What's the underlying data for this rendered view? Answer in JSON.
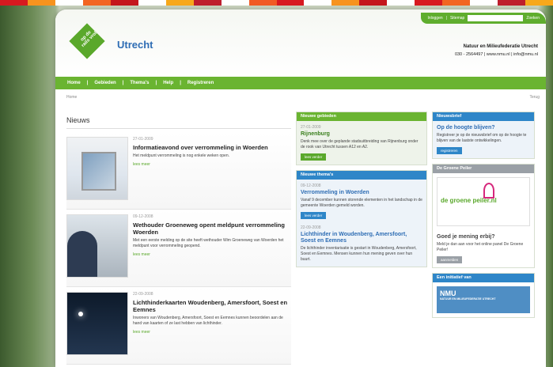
{
  "stripe_colors": [
    "#d71920",
    "#f7931e",
    "#ffffff",
    "#f26522",
    "#c4161c",
    "#ffffff",
    "#f7a81b",
    "#be1e2d",
    "#ffffff",
    "#f15a24",
    "#d71920",
    "#ffffff",
    "#f7931e",
    "#c4161c",
    "#ffffff",
    "#d71920",
    "#f26522",
    "#ffffff",
    "#be1e2d",
    "#f7a81b"
  ],
  "topbar": {
    "login": "Inloggen",
    "sep": "|",
    "sitemap": "Sitemap",
    "search_placeholder": "",
    "search_button": "Zoeken"
  },
  "logo": {
    "text": "op de rails vrol",
    "site": "Utrecht"
  },
  "org": {
    "name": "Natuur en Milieufederatie Utrecht",
    "contact": "030 - 2564497 | www.nmu.nl | info@nmu.nl"
  },
  "nav": [
    "Home",
    "Gebieden",
    "Thema's",
    "Help",
    "Registreren"
  ],
  "breadcrumb": {
    "left": "Home",
    "right": "Terug"
  },
  "news": {
    "heading": "Nieuws",
    "items": [
      {
        "date": "27-01-2009",
        "title": "Informatieavond over verrommeling in Woerden",
        "desc": "Het meldpunt verrommeling is nog enkele weken open.",
        "more": "lees meer"
      },
      {
        "date": "09-12-2008",
        "title": "Wethouder Groeneweg opent meldpunt verrommeling Woerden",
        "desc": "Met een eerste melding op de site heeft wethouder Wim Groeneweg van Woerden het meldpunt voor verrommeling geopend.",
        "more": "lees meer"
      },
      {
        "date": "22-09-2008",
        "title": "Lichthinderkaarten Woudenberg, Amersfoort, Soest en Eemnes",
        "desc": "Inwoners van Woudenberg, Amersfoort, Soest en Eemnes kunnen beoordelen aan de hand van kaarten of ze last hebben van lichthinder.",
        "more": "lees meer"
      }
    ]
  },
  "gebieden": {
    "header": "Nieuwe gebieden",
    "date": "27-01-2009",
    "title": "Rijnenburg",
    "desc": "Denk mee over de geplande stadsuitbreiding van Rijnenburg onder de rook van Utrecht tussen A12 en A2.",
    "button": "lees verder"
  },
  "themas": {
    "header": "Nieuwe thema's",
    "items": [
      {
        "date": "09-12-2008",
        "title": "Verrommeling in Woerden",
        "desc": "Vanaf 9 december kunnen storende elementen in het landschap in de gemeente Woerden gemeld worden.",
        "button": "lees verder"
      },
      {
        "date": "22-09-2008",
        "title": "Lichthinder in Woudenberg, Amersfoort, Soest en Eemnes",
        "desc": "De lichthinder inventarisatie is gestart in Woudenberg, Amersfoort, Soest en Eemnes. Mensen kunnen hun mening geven over hun buurt."
      }
    ]
  },
  "newsletter": {
    "header": "Nieuwsbrief",
    "title": "Op de hoogte blijven?",
    "desc": "Registreer je op de nieuwsbrief om op de hoogte te blijven van de laatste ontwikkelingen.",
    "button": "registreren"
  },
  "peiler": {
    "header": "De Groene Peiler",
    "logo_text": "de groene peiler.nl",
    "question": "Goed je mening erbij?",
    "desc": "Meld je dan aan voor het online panel De Groene Peiler!",
    "button": "aanmelden"
  },
  "initiative": {
    "header": "Een initiatief van",
    "logo": "NMU",
    "subtitle": "NATUUR EN MILIEUFEDERATIE UTRECHT"
  }
}
